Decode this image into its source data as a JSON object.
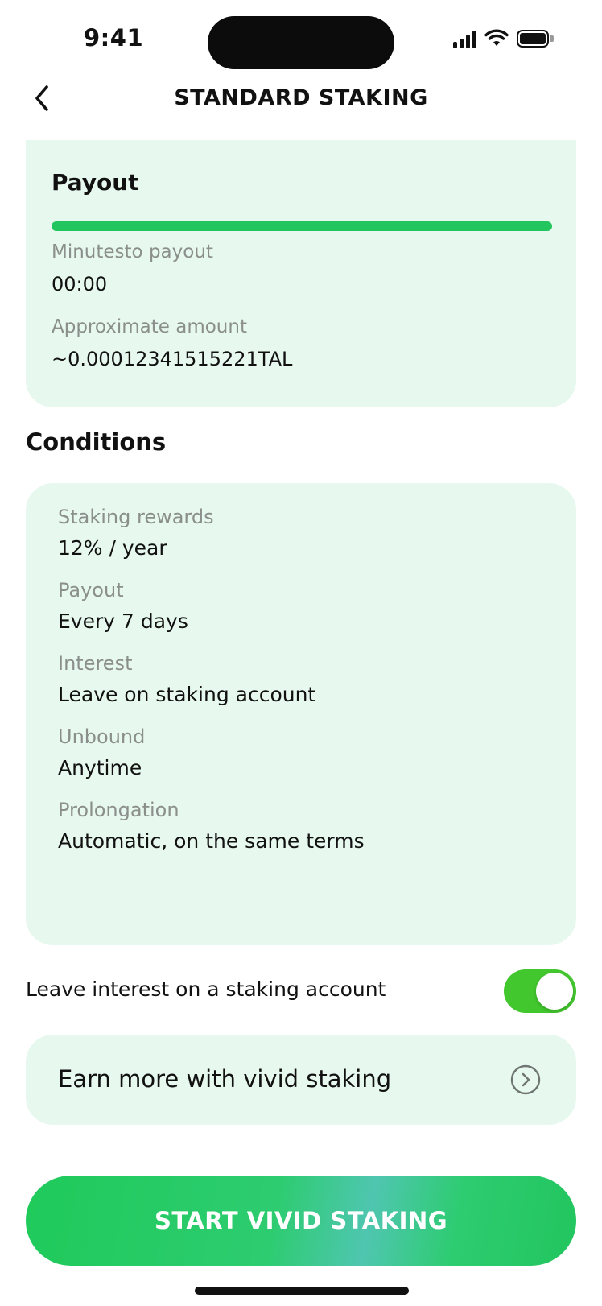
{
  "status_bar": {
    "time": "9:41",
    "icons": [
      "signal-icon",
      "wifi-icon",
      "battery-icon"
    ]
  },
  "header": {
    "title": "STANDARD STAKING",
    "back_icon": "chevron-left-icon"
  },
  "payout": {
    "title": "Payout",
    "progress": 1.0,
    "minutes_label": "Minutesto payout",
    "minutes_value": "00:00",
    "amount_label": "Approximate amount",
    "amount_value": "~0.00012341515221TAL"
  },
  "conditions": {
    "title": "Conditions",
    "items": [
      {
        "label": "Staking rewards",
        "value": "12% / year"
      },
      {
        "label": "Payout",
        "value": "Every 7 days"
      },
      {
        "label": "Interest",
        "value": "Leave on staking account"
      },
      {
        "label": "Unbound",
        "value": "Anytime"
      },
      {
        "label": "Prolongation",
        "value": "Automatic, on the same terms"
      }
    ]
  },
  "toggle": {
    "label": "Leave interest on a staking account",
    "on": true
  },
  "vivid_link": {
    "label": "Earn more with vivid staking",
    "icon": "chevron-right-circle-icon"
  },
  "cta": {
    "label": "START VIVID STAKING"
  },
  "colors": {
    "accent": "#22c55e",
    "toggle_on": "#43c72e",
    "card_bg": "#e7f8ee",
    "muted_text": "#8b8f8c"
  }
}
